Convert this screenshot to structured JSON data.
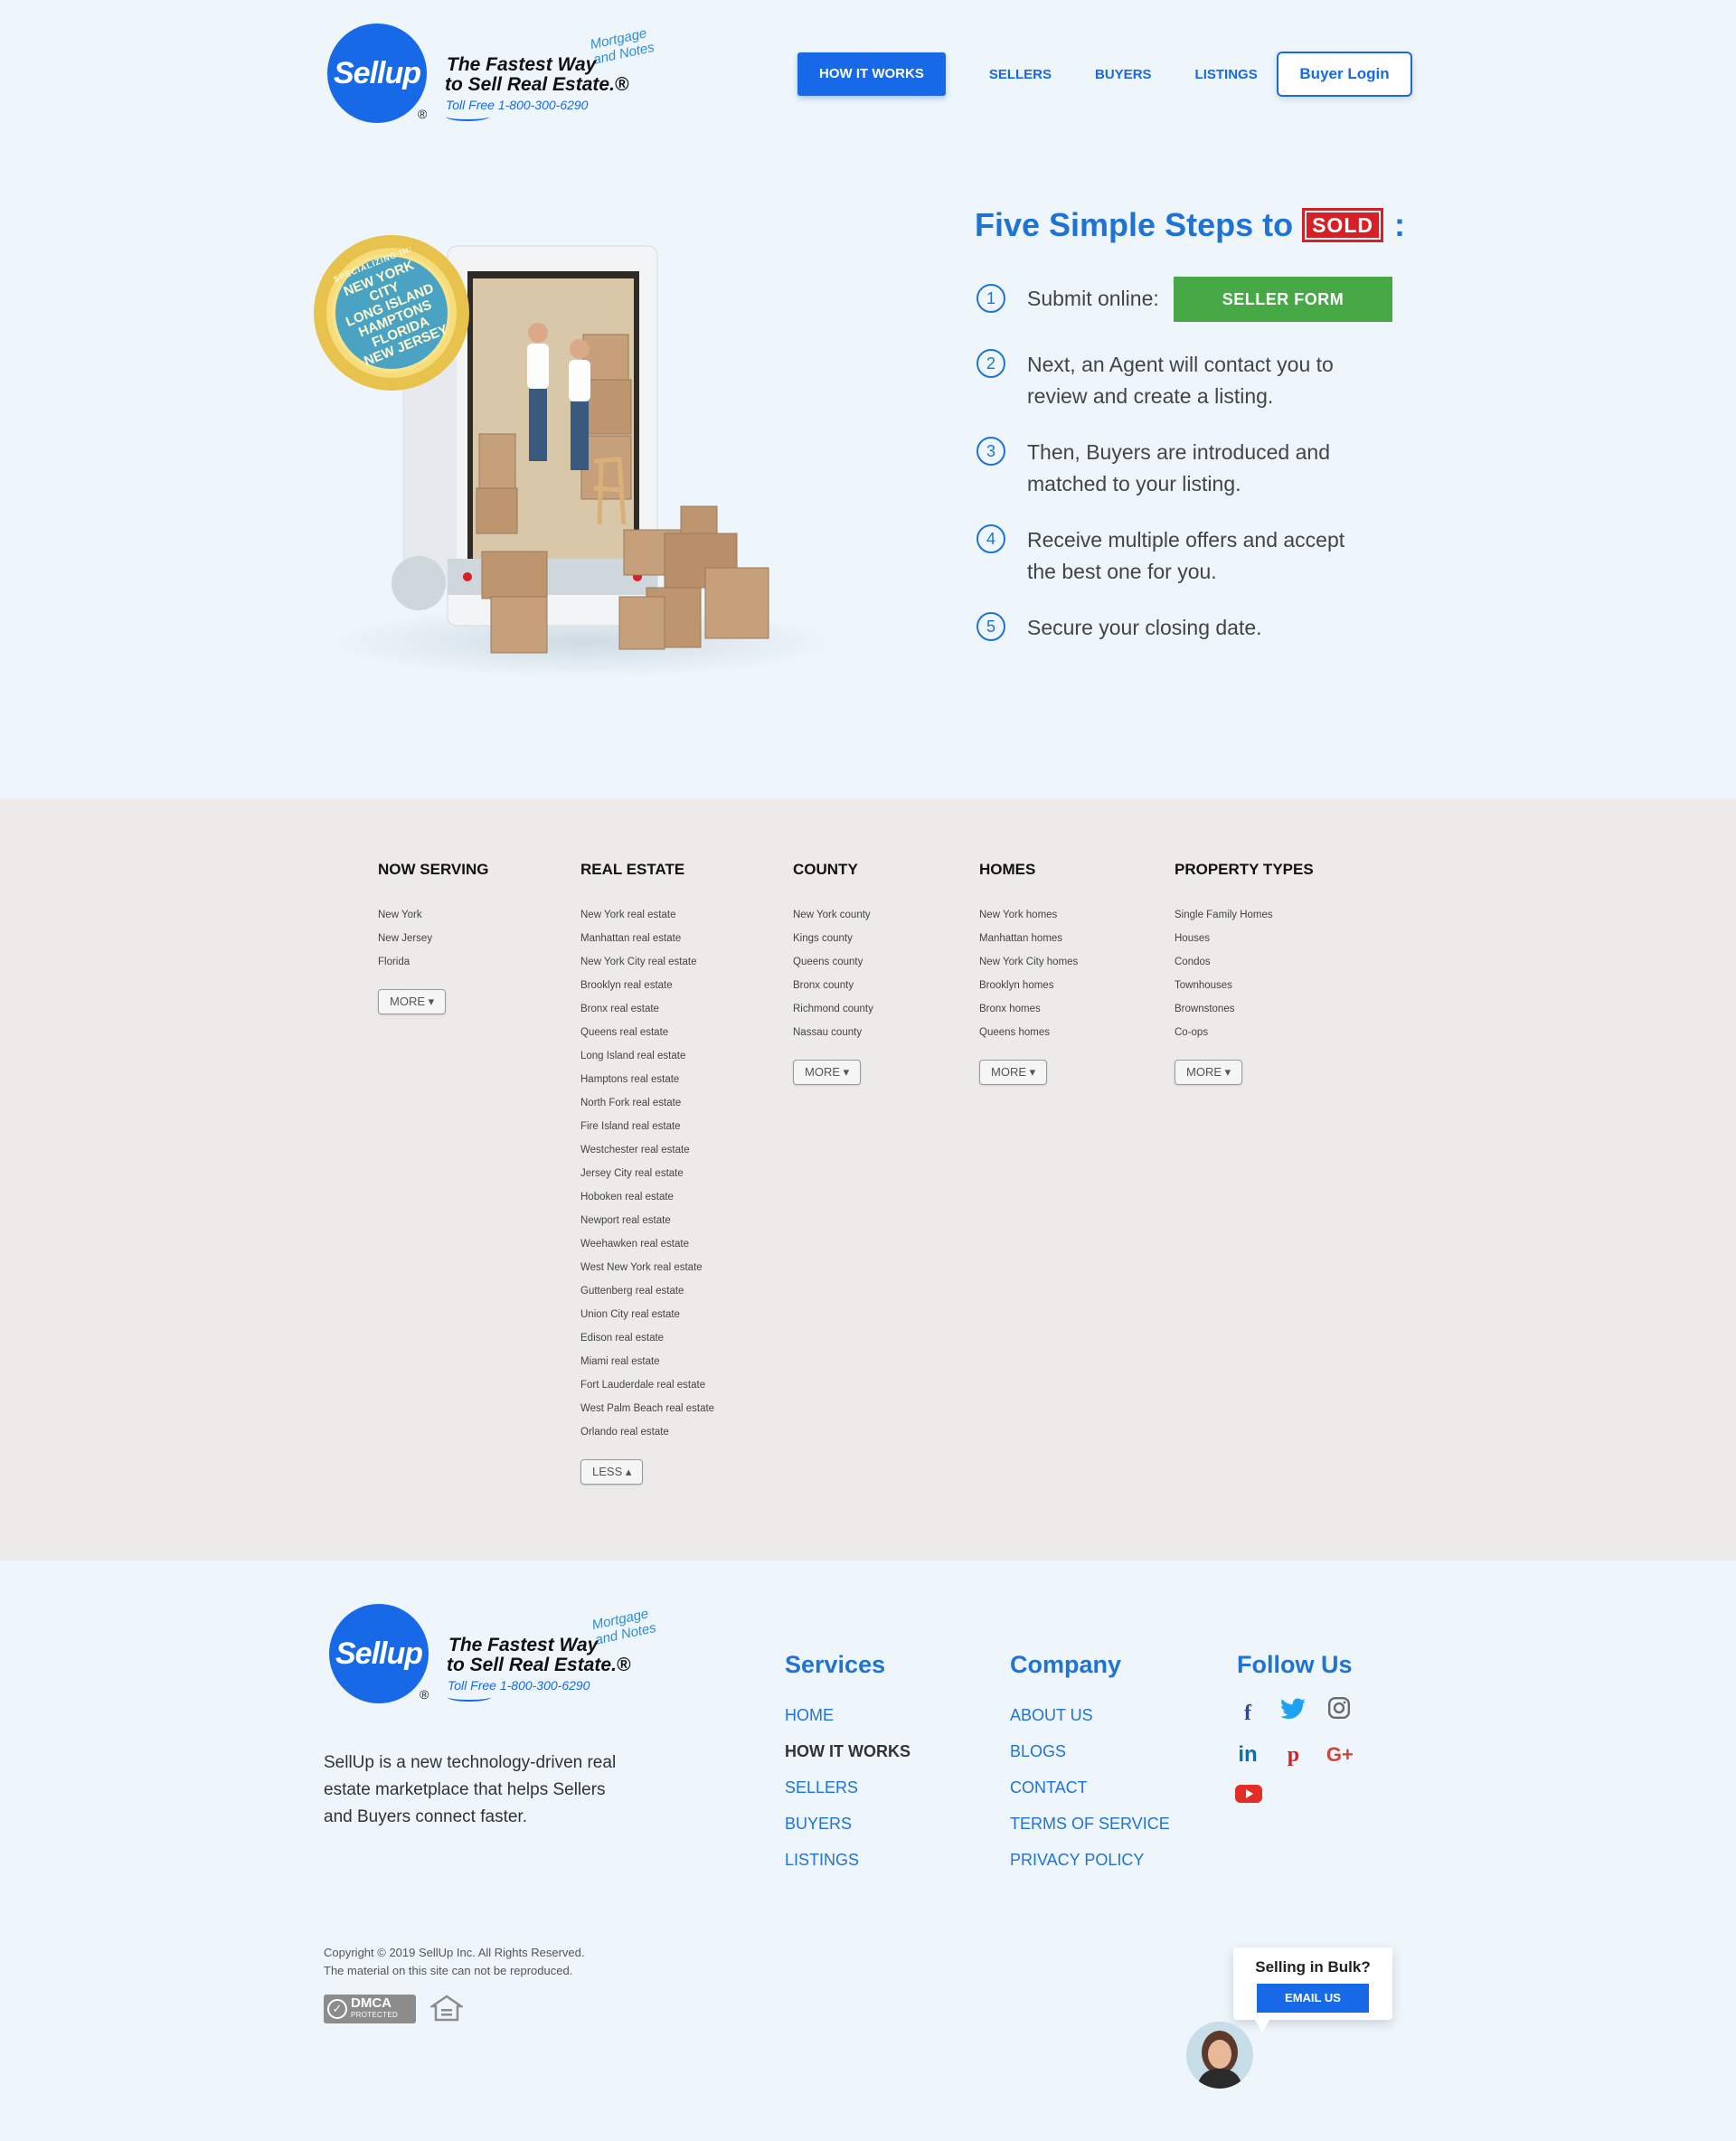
{
  "brand": {
    "logo_text": "Sellup",
    "registered": "®",
    "tagline_line1": "The Fastest Way",
    "tagline_line2": "to Sell Real Estate.®",
    "mortgage": "and Notes",
    "mortgage_top": "Mortgage",
    "tollfree": "Toll Free 1-800-300-6290"
  },
  "nav": {
    "items": [
      "HOW IT WORKS",
      "SELLERS",
      "BUYERS",
      "LISTINGS"
    ],
    "active": "HOW IT WORKS",
    "login": "Buyer Login"
  },
  "hero": {
    "badge_title": "SPECIALIZING IN:",
    "badge_places": [
      "NEW YORK CITY",
      "LONG ISLAND",
      "HAMPTONS",
      "FLORIDA",
      "NEW JERSEY"
    ],
    "title": "Five Simple Steps to",
    "sold": "SOLD",
    "colon": ":",
    "steps": [
      {
        "num": "1",
        "text": "Submit online:"
      },
      {
        "num": "2",
        "text": "Next, an Agent will contact you to review and create a listing."
      },
      {
        "num": "3",
        "text": "Then, Buyers are introduced and matched to your listing."
      },
      {
        "num": "4",
        "text": "Receive multiple offers and accept the best one for you."
      },
      {
        "num": "5",
        "text": "Secure your closing date."
      }
    ],
    "seller_form": "SELLER  FORM"
  },
  "directory": {
    "columns": [
      {
        "title": "NOW SERVING",
        "items": [
          "New York",
          "New Jersey",
          "Florida"
        ],
        "button": "MORE ▾"
      },
      {
        "title": "REAL ESTATE",
        "items": [
          "New York real estate",
          "Manhattan real estate",
          "New York City real estate",
          "Brooklyn real estate",
          "Bronx real estate",
          "Queens real estate",
          "Long Island real estate",
          "Hamptons real estate",
          "North Fork real estate",
          "Fire Island real estate",
          "Westchester real estate",
          "Jersey City real estate",
          "Hoboken real estate",
          "Newport real estate",
          "Weehawken real estate",
          "West New York real estate",
          "Guttenberg real estate",
          "Union City real estate",
          "Edison real estate",
          "Miami real estate",
          "Fort Lauderdale real estate",
          "West Palm Beach real estate",
          "Orlando real estate"
        ],
        "button": "LESS ▴"
      },
      {
        "title": "COUNTY",
        "items": [
          "New York county",
          "Kings county",
          "Queens county",
          "Bronx county",
          "Richmond county",
          "Nassau county"
        ],
        "button": "MORE ▾"
      },
      {
        "title": "HOMES",
        "items": [
          "New York homes",
          "Manhattan homes",
          "New York City homes",
          "Brooklyn homes",
          "Bronx homes",
          "Queens homes"
        ],
        "button": "MORE ▾"
      },
      {
        "title": "PROPERTY TYPES",
        "items": [
          "Single Family Homes",
          "Houses",
          "Condos",
          "Townhouses",
          "Brownstones",
          "Co-ops"
        ],
        "button": "MORE ▾"
      }
    ]
  },
  "footer": {
    "about": "SellUp is a new technology-driven real estate marketplace that helps Sellers and Buyers connect faster.",
    "services": {
      "title": "Services",
      "links": [
        "HOME",
        "HOW IT WORKS",
        "SELLERS",
        "BUYERS",
        "LISTINGS"
      ],
      "current": "HOW IT WORKS"
    },
    "company": {
      "title": "Company",
      "links": [
        "ABOUT US",
        "BLOGS",
        "CONTACT",
        "TERMS OF SERVICE",
        "PRIVACY POLICY"
      ]
    },
    "follow": {
      "title": "Follow Us",
      "icons": [
        "facebook-icon",
        "twitter-icon",
        "instagram-icon",
        "linkedin-icon",
        "pinterest-icon",
        "google-plus-icon",
        "youtube-icon"
      ]
    },
    "copyright_line1": "Copyright © 2019 SellUp Inc. All Rights Reserved.",
    "copyright_line2": "The material on this site can not be reproduced.",
    "dmca": "DMCA",
    "dmca_sub": "PROTECTED",
    "bulk_title": "Selling in Bulk?",
    "bulk_button": "EMAIL US"
  },
  "colors": {
    "brand_blue": "#1769e8",
    "heading_blue": "#1f73d4",
    "green": "#47a846",
    "sold_red": "#d61f26",
    "bg": "#eef6fc",
    "directory_bg": "#ecebe9"
  }
}
